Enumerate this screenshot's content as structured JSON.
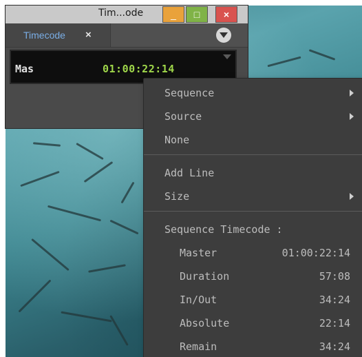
{
  "window": {
    "title": "Tim...ode",
    "minimize_label": "_",
    "maximize_label": "□",
    "close_label": "×"
  },
  "tab": {
    "label": "Timecode",
    "close_label": "×"
  },
  "display": {
    "label": "Mas",
    "value": "01:00:22:14"
  },
  "menu": {
    "items_top": [
      {
        "label": "Sequence",
        "submenu": true
      },
      {
        "label": "Source",
        "submenu": true
      },
      {
        "label": "None",
        "submenu": false
      }
    ],
    "items_mid": [
      {
        "label": "Add Line",
        "submenu": false
      },
      {
        "label": "Size",
        "submenu": true
      }
    ],
    "section_header": "Sequence Timecode :",
    "timecode_rows": [
      {
        "label": "Master",
        "value": "01:00:22:14"
      },
      {
        "label": "Duration",
        "value": "57:08"
      },
      {
        "label": "In/Out",
        "value": "34:24"
      },
      {
        "label": "Absolute",
        "value": "22:14"
      },
      {
        "label": "Remain",
        "value": "34:24"
      }
    ]
  },
  "colors": {
    "timecode_green": "#9fd64a",
    "tab_blue": "#7aaee6",
    "minimize_orange": "#e9a23b",
    "maximize_green": "#80b347",
    "close_red": "#d9534f"
  }
}
